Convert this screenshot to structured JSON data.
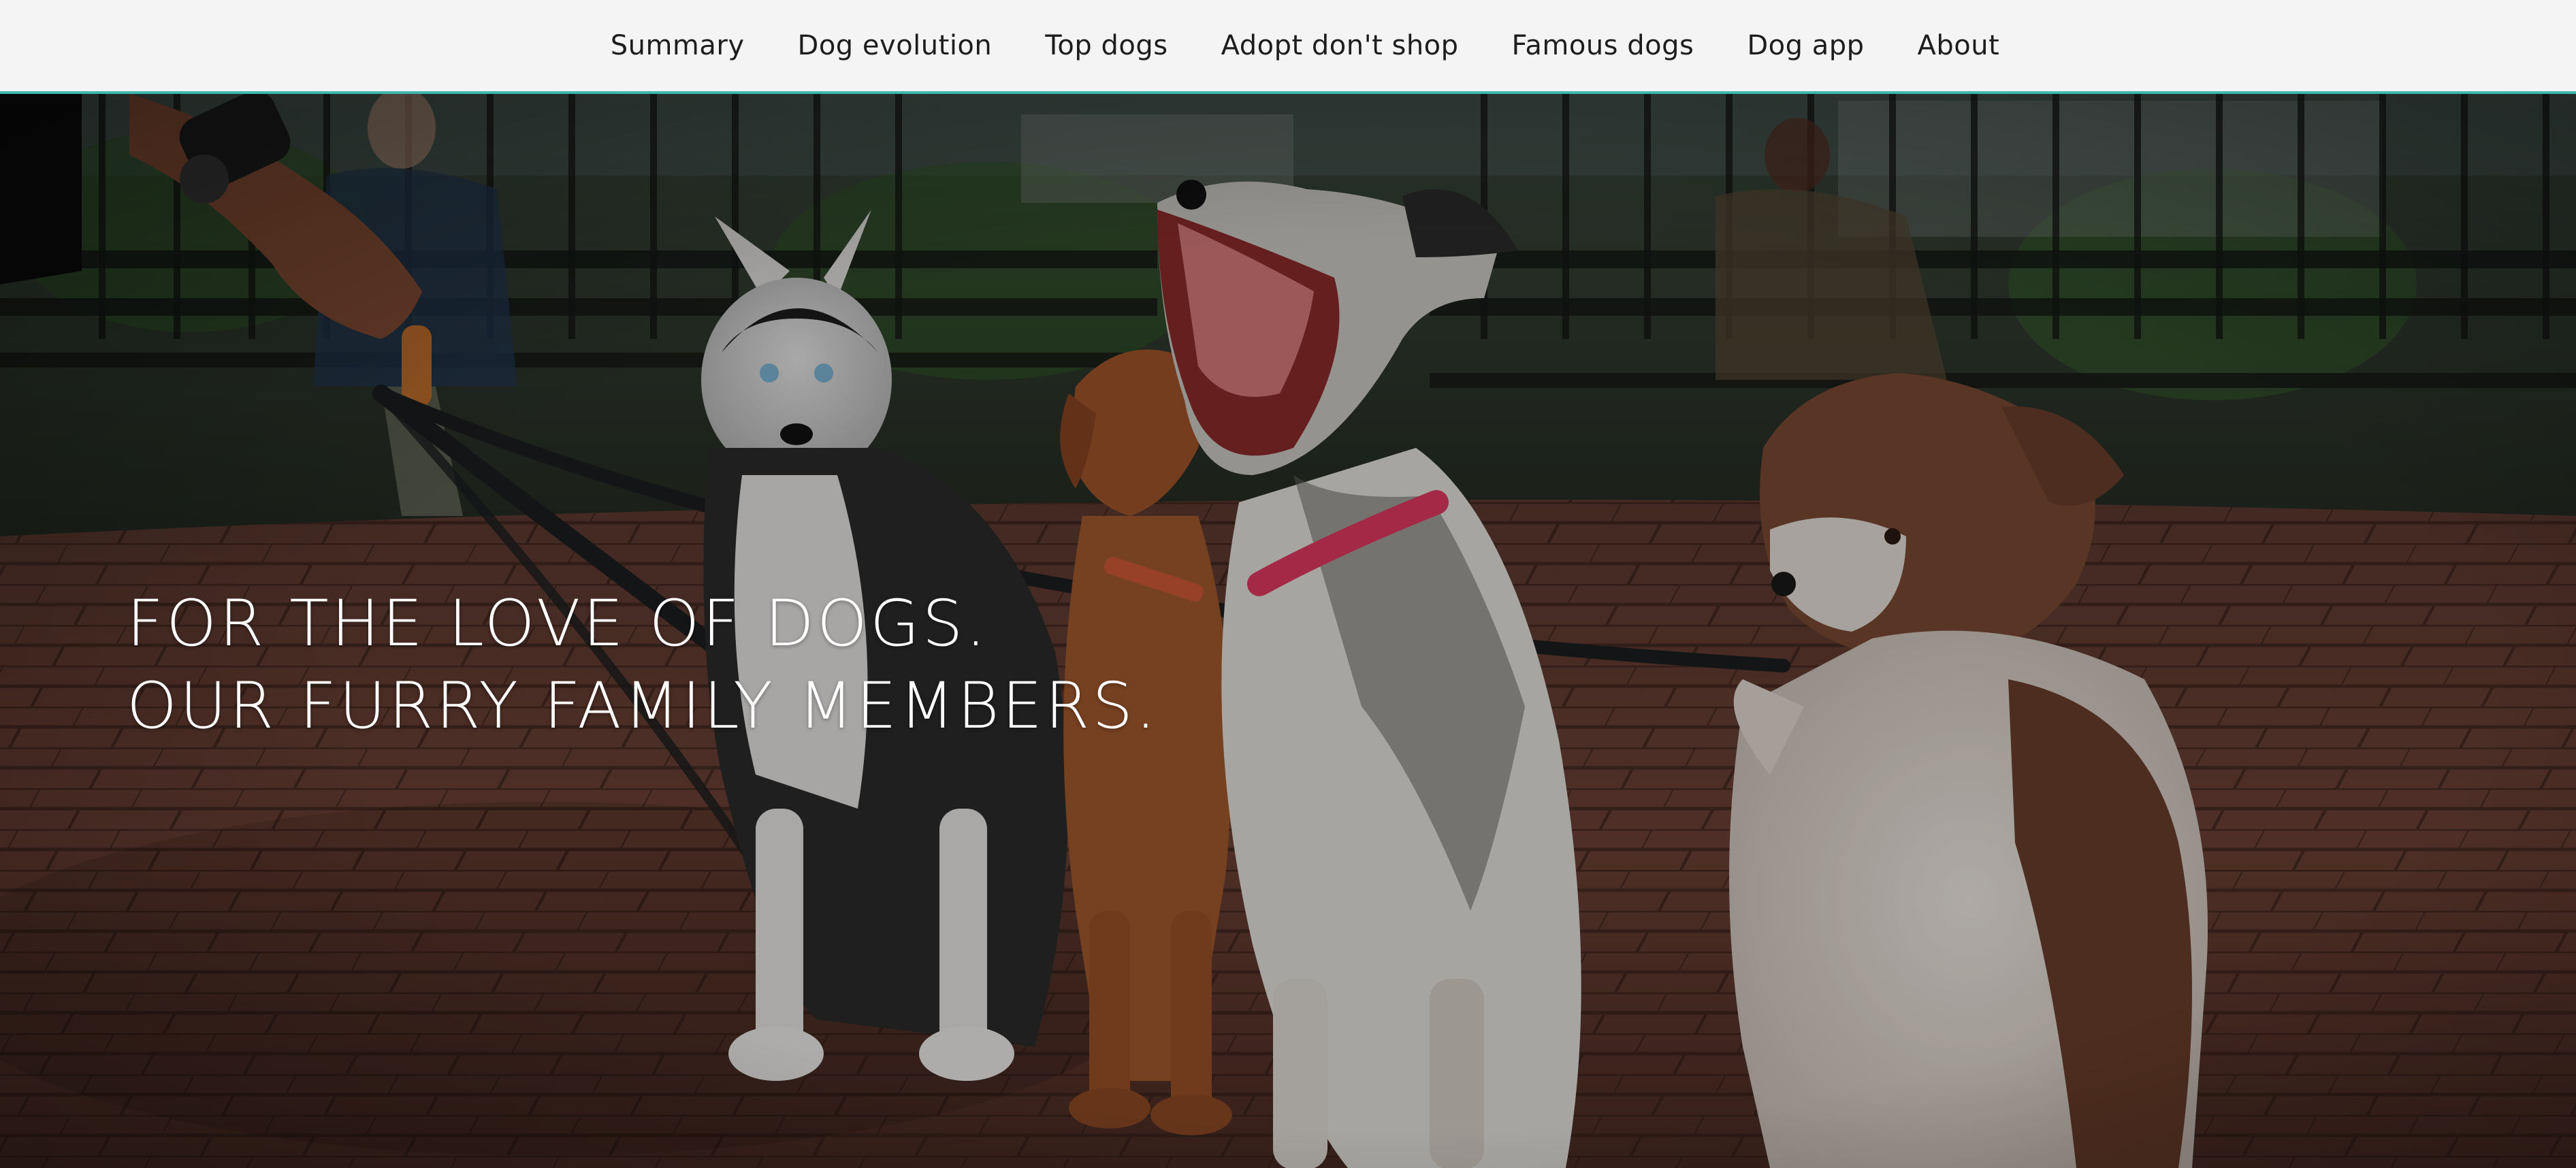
{
  "nav": {
    "items": [
      {
        "label": "Summary"
      },
      {
        "label": "Dog evolution"
      },
      {
        "label": "Top dogs"
      },
      {
        "label": "Adopt don't shop"
      },
      {
        "label": "Famous dogs"
      },
      {
        "label": "Dog app"
      },
      {
        "label": "About"
      }
    ]
  },
  "hero": {
    "line1": "FOR THE LOVE OF DOGS.",
    "line2": "OUR FURRY FAMILY MEMBERS."
  },
  "colors": {
    "nav_background": "#f4f4f4",
    "nav_border_accent": "#3fb7ae",
    "nav_text": "#1d1d1d",
    "hero_text": "#ffffff"
  }
}
